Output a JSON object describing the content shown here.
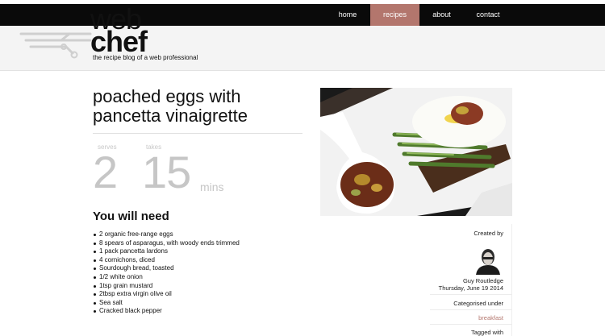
{
  "nav": {
    "items": [
      {
        "label": "home"
      },
      {
        "label": "recipes"
      },
      {
        "label": "about"
      },
      {
        "label": "contact"
      }
    ],
    "active": "recipes"
  },
  "brand": {
    "word1": "web",
    "word2": "chef",
    "tagline": "the recipe blog of a web professional"
  },
  "recipe": {
    "title": "poached eggs with pancetta vinaigrette",
    "serves_label": "serves",
    "serves_value": "2",
    "takes_label": "takes",
    "takes_value": "15",
    "takes_unit": "mins",
    "need_heading": "You will need",
    "ingredients": [
      "2 organic free-range eggs",
      "8 spears of asparagus, with woody ends trimmed",
      "1 pack pancetta lardons",
      "4 cornichons, diced",
      "Sourdough bread, toasted",
      "1/2 white onion",
      "1tsp grain mustard",
      "2tbsp extra virgin olive oil",
      "Sea salt",
      "Cracked black pepper"
    ]
  },
  "sidebar": {
    "created_by_label": "Created by",
    "author": "Guy Routledge",
    "date": "Thursday, June 19 2014",
    "categorised_label": "Categorised under",
    "category": "breakfast",
    "tagged_label": "Tagged with"
  },
  "colors": {
    "accent": "#b3766d",
    "nav_bg": "#0a0a0a",
    "muted": "#c6c6c6"
  }
}
